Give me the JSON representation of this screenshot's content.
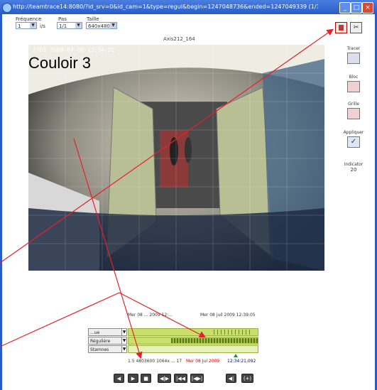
{
  "window": {
    "title": "http://teamtrace14:8080/?id_srv=0&id_cam=1&type=regul&begin=1247048736&ended=1247049339   (1/1) ...",
    "minimize": "_",
    "maximize": "□",
    "close": "×"
  },
  "toolbar": {
    "frequence_label": "Fréquence",
    "frequence_value": "1",
    "frequence_unit": "i/s",
    "pas_label": "Pas",
    "pas_value": "1/1",
    "taille_label": "Taille",
    "taille_value": "640x480"
  },
  "camera": {
    "name": "Axis212_164",
    "timestamp": "2701 2009-07-08 12:34:2C",
    "label": "Couloir 3"
  },
  "side_tools": [
    {
      "label": "Tracer",
      "icon": "draw-icon"
    },
    {
      "label": "Bloc",
      "icon": "block-grid-icon"
    },
    {
      "label": "Grille",
      "icon": "grid-icon"
    },
    {
      "label": "Appliquer",
      "icon": "apply-check-icon"
    },
    {
      "label": "Indicator",
      "icon": ""
    }
  ],
  "indicator_value": "20",
  "timeline": {
    "header_left": "Mer 08 ... 2009 12:...",
    "header_right": "Mer 08 juil 2009 12:39:05",
    "rows": [
      {
        "label": "...ue"
      },
      {
        "label": "Régulière"
      },
      {
        "label": "Stamnes"
      }
    ],
    "footer_left": "1.5  4803600 1064x ... 17",
    "footer_date": "Mer 08 Jul 2009",
    "footer_time": "12:34:21,092"
  },
  "playback": {
    "buttons": [
      "◀",
      "▶",
      "■",
      "◀|▶",
      "|◀◀",
      "|◀▶|",
      "◀|",
      "(+)"
    ]
  },
  "colors": {
    "arrow": "#e8202a",
    "timeline_bar": "#c8e06a",
    "titlebar": "#2a5cc9"
  }
}
